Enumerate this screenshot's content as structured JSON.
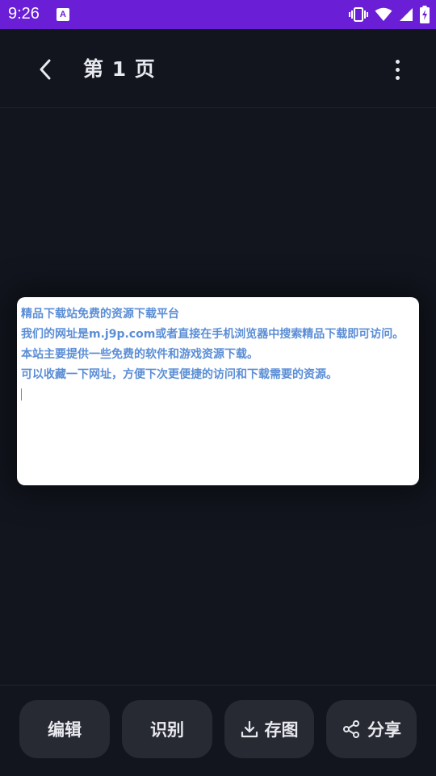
{
  "status_bar": {
    "time": "9:26",
    "app_icon_letter": "A",
    "icons": [
      "vibrate-icon",
      "wifi-icon",
      "signal-icon",
      "battery-charging-icon"
    ]
  },
  "app_bar": {
    "title": "第 1 页",
    "back_icon": "chevron-left-icon",
    "more_icon": "more-vertical-icon"
  },
  "document": {
    "lines": [
      "精品下载站免费的资源下载平台",
      "我们的网址是m.j9p.com或者直接在手机浏览器中搜索精品下载即可访问。",
      "本站主要提供一些免费的软件和游戏资源下载。",
      "可以收藏一下网址，方便下次更便捷的访问和下载需要的资源。"
    ],
    "text_color": "#5b8ed6"
  },
  "actions": {
    "edit_label": "编辑",
    "recognize_label": "识别",
    "save_label": "存图",
    "share_label": "分享"
  },
  "colors": {
    "status_bar": "#6a1fd6",
    "background": "#12151e",
    "button_bg": "#272a33"
  }
}
